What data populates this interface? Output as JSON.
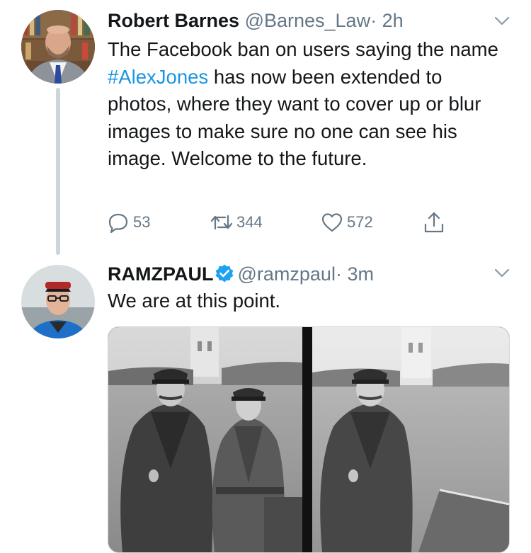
{
  "tweets": [
    {
      "name": "Robert Barnes",
      "handle": "@Barnes_Law",
      "separator": "·",
      "time": "2h",
      "text_before": "The Facebook ban on users saying the name ",
      "hashtag": "#AlexJones",
      "text_after": " has now been extended to photos, where they want to cover up or blur images to make sure no one can see his image. Welcome to the future.",
      "actions": {
        "replies": "53",
        "retweets": "344",
        "likes": "572"
      }
    },
    {
      "name": "RAMZPAUL",
      "handle": "@ramzpaul",
      "separator": "·",
      "time": "3m",
      "verified": true,
      "text": "We are at this point."
    }
  ],
  "colors": {
    "link": "#1b95e0",
    "secondary_text": "#657786",
    "thread_line": "#cdd6dd",
    "verified": "#1da1f2"
  },
  "icons": [
    "caret-down-icon",
    "reply-icon",
    "retweet-icon",
    "like-icon",
    "share-icon",
    "verified-badge-icon"
  ]
}
